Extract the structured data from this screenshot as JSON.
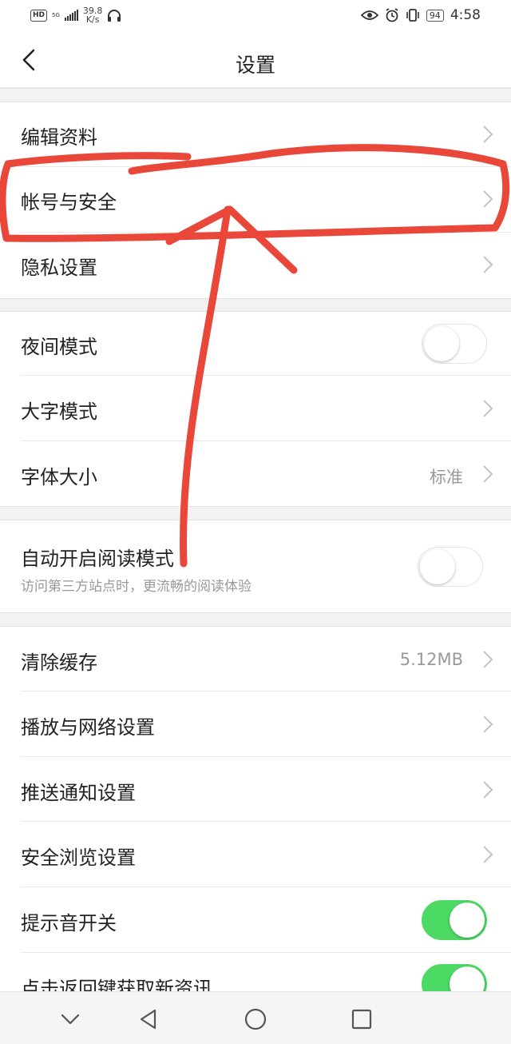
{
  "status_bar": {
    "hd": "HD",
    "network": "5G",
    "speed_value": "39.8",
    "speed_unit": "K/s",
    "battery": "94",
    "time": "4:58"
  },
  "header": {
    "title": "设置"
  },
  "settings": [
    {
      "label": "编辑资料"
    },
    {
      "label": "帐号与安全"
    },
    {
      "label": "隐私设置"
    },
    {
      "label": "夜间模式",
      "toggle": "off"
    },
    {
      "label": "大字模式"
    },
    {
      "label": "字体大小",
      "value": "标准"
    },
    {
      "label": "自动开启阅读模式",
      "sub": "访问第三方站点时，更流畅的阅读体验",
      "toggle": "off"
    },
    {
      "label": "清除缓存",
      "value": "5.12MB"
    },
    {
      "label": "播放与网络设置"
    },
    {
      "label": "推送通知设置"
    },
    {
      "label": "安全浏览设置"
    },
    {
      "label": "提示音开关",
      "toggle": "on"
    },
    {
      "label": "点击返回键获取新资讯",
      "toggle": "on"
    }
  ],
  "colors": {
    "toggle_on": "#4cd964",
    "annotation": "#e8473a"
  },
  "icons": [
    "back-arrow-icon",
    "chevron-right-icon",
    "nav-hide-icon",
    "nav-back-icon",
    "nav-home-icon",
    "nav-recents-icon"
  ]
}
